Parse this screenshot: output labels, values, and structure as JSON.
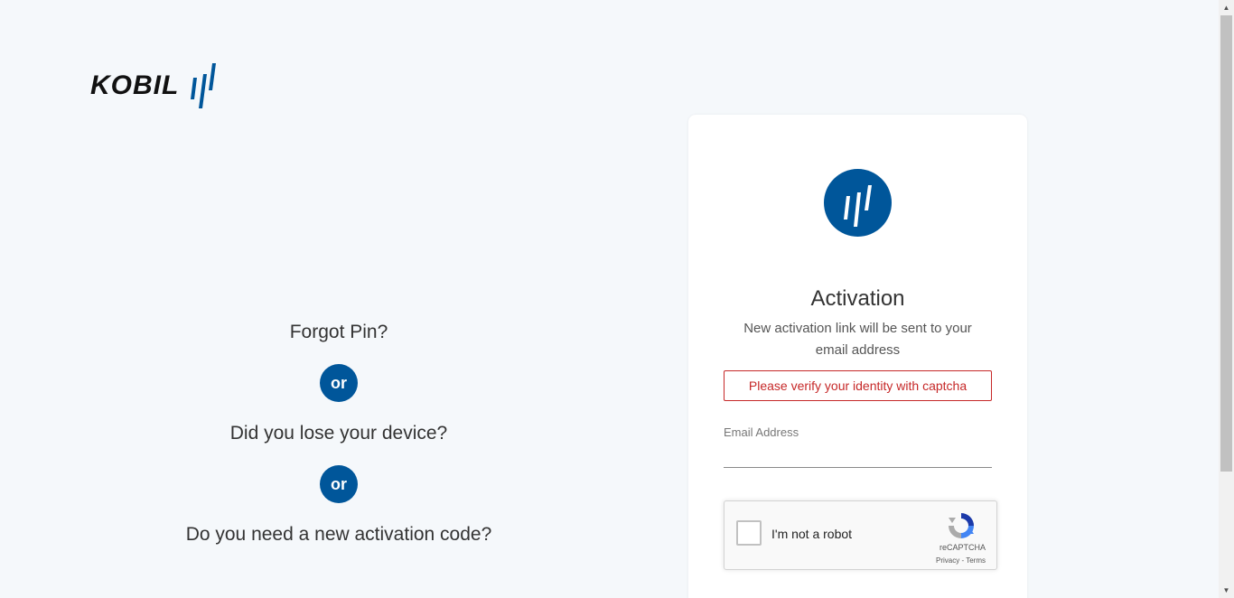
{
  "brand": {
    "name": "KOBIL",
    "accent_color": "#00569a"
  },
  "options": {
    "forgot_pin": "Forgot Pin?",
    "or_1": "or",
    "lost_device": "Did you lose your device?",
    "or_2": "or",
    "new_code": "Do you need a new activation code?"
  },
  "card": {
    "logo_icon": "kobil-mark-icon",
    "title": "Activation",
    "subtitle": "New activation link will be sent to your email address",
    "error": "Please verify your identity with captcha",
    "email_label": "Email Address",
    "email_value": ""
  },
  "recaptcha": {
    "label": "I'm not a robot",
    "brand": "reCAPTCHA",
    "links": "Privacy - Terms",
    "checked": false
  },
  "scrollbar": {
    "up_icon": "scroll-up-icon",
    "down_icon": "scroll-down-icon"
  }
}
